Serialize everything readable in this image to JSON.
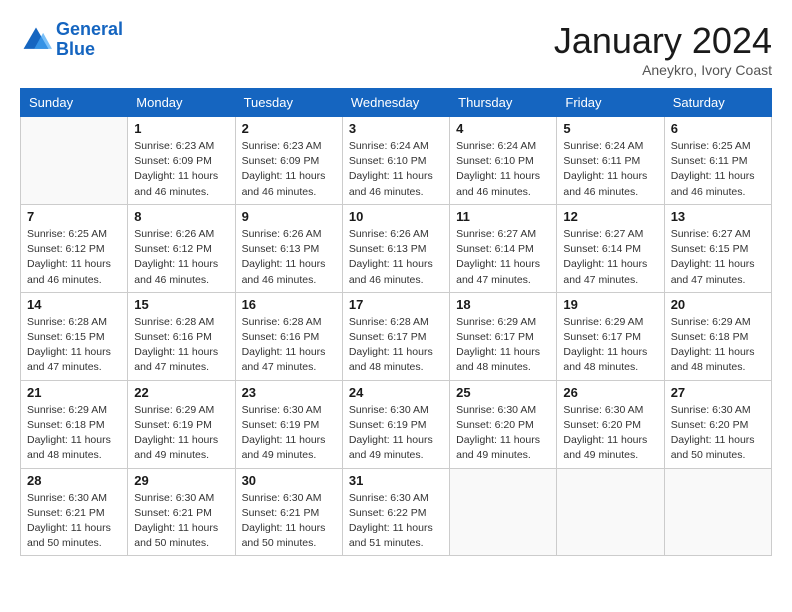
{
  "header": {
    "logo_line1": "General",
    "logo_line2": "Blue",
    "month_title": "January 2024",
    "location": "Aneykro, Ivory Coast"
  },
  "weekdays": [
    "Sunday",
    "Monday",
    "Tuesday",
    "Wednesday",
    "Thursday",
    "Friday",
    "Saturday"
  ],
  "weeks": [
    [
      {
        "day": "",
        "info": ""
      },
      {
        "day": "1",
        "info": "Sunrise: 6:23 AM\nSunset: 6:09 PM\nDaylight: 11 hours and 46 minutes."
      },
      {
        "day": "2",
        "info": "Sunrise: 6:23 AM\nSunset: 6:09 PM\nDaylight: 11 hours and 46 minutes."
      },
      {
        "day": "3",
        "info": "Sunrise: 6:24 AM\nSunset: 6:10 PM\nDaylight: 11 hours and 46 minutes."
      },
      {
        "day": "4",
        "info": "Sunrise: 6:24 AM\nSunset: 6:10 PM\nDaylight: 11 hours and 46 minutes."
      },
      {
        "day": "5",
        "info": "Sunrise: 6:24 AM\nSunset: 6:11 PM\nDaylight: 11 hours and 46 minutes."
      },
      {
        "day": "6",
        "info": "Sunrise: 6:25 AM\nSunset: 6:11 PM\nDaylight: 11 hours and 46 minutes."
      }
    ],
    [
      {
        "day": "7",
        "info": "Sunrise: 6:25 AM\nSunset: 6:12 PM\nDaylight: 11 hours and 46 minutes."
      },
      {
        "day": "8",
        "info": "Sunrise: 6:26 AM\nSunset: 6:12 PM\nDaylight: 11 hours and 46 minutes."
      },
      {
        "day": "9",
        "info": "Sunrise: 6:26 AM\nSunset: 6:13 PM\nDaylight: 11 hours and 46 minutes."
      },
      {
        "day": "10",
        "info": "Sunrise: 6:26 AM\nSunset: 6:13 PM\nDaylight: 11 hours and 46 minutes."
      },
      {
        "day": "11",
        "info": "Sunrise: 6:27 AM\nSunset: 6:14 PM\nDaylight: 11 hours and 47 minutes."
      },
      {
        "day": "12",
        "info": "Sunrise: 6:27 AM\nSunset: 6:14 PM\nDaylight: 11 hours and 47 minutes."
      },
      {
        "day": "13",
        "info": "Sunrise: 6:27 AM\nSunset: 6:15 PM\nDaylight: 11 hours and 47 minutes."
      }
    ],
    [
      {
        "day": "14",
        "info": "Sunrise: 6:28 AM\nSunset: 6:15 PM\nDaylight: 11 hours and 47 minutes."
      },
      {
        "day": "15",
        "info": "Sunrise: 6:28 AM\nSunset: 6:16 PM\nDaylight: 11 hours and 47 minutes."
      },
      {
        "day": "16",
        "info": "Sunrise: 6:28 AM\nSunset: 6:16 PM\nDaylight: 11 hours and 47 minutes."
      },
      {
        "day": "17",
        "info": "Sunrise: 6:28 AM\nSunset: 6:17 PM\nDaylight: 11 hours and 48 minutes."
      },
      {
        "day": "18",
        "info": "Sunrise: 6:29 AM\nSunset: 6:17 PM\nDaylight: 11 hours and 48 minutes."
      },
      {
        "day": "19",
        "info": "Sunrise: 6:29 AM\nSunset: 6:17 PM\nDaylight: 11 hours and 48 minutes."
      },
      {
        "day": "20",
        "info": "Sunrise: 6:29 AM\nSunset: 6:18 PM\nDaylight: 11 hours and 48 minutes."
      }
    ],
    [
      {
        "day": "21",
        "info": "Sunrise: 6:29 AM\nSunset: 6:18 PM\nDaylight: 11 hours and 48 minutes."
      },
      {
        "day": "22",
        "info": "Sunrise: 6:29 AM\nSunset: 6:19 PM\nDaylight: 11 hours and 49 minutes."
      },
      {
        "day": "23",
        "info": "Sunrise: 6:30 AM\nSunset: 6:19 PM\nDaylight: 11 hours and 49 minutes."
      },
      {
        "day": "24",
        "info": "Sunrise: 6:30 AM\nSunset: 6:19 PM\nDaylight: 11 hours and 49 minutes."
      },
      {
        "day": "25",
        "info": "Sunrise: 6:30 AM\nSunset: 6:20 PM\nDaylight: 11 hours and 49 minutes."
      },
      {
        "day": "26",
        "info": "Sunrise: 6:30 AM\nSunset: 6:20 PM\nDaylight: 11 hours and 49 minutes."
      },
      {
        "day": "27",
        "info": "Sunrise: 6:30 AM\nSunset: 6:20 PM\nDaylight: 11 hours and 50 minutes."
      }
    ],
    [
      {
        "day": "28",
        "info": "Sunrise: 6:30 AM\nSunset: 6:21 PM\nDaylight: 11 hours and 50 minutes."
      },
      {
        "day": "29",
        "info": "Sunrise: 6:30 AM\nSunset: 6:21 PM\nDaylight: 11 hours and 50 minutes."
      },
      {
        "day": "30",
        "info": "Sunrise: 6:30 AM\nSunset: 6:21 PM\nDaylight: 11 hours and 50 minutes."
      },
      {
        "day": "31",
        "info": "Sunrise: 6:30 AM\nSunset: 6:22 PM\nDaylight: 11 hours and 51 minutes."
      },
      {
        "day": "",
        "info": ""
      },
      {
        "day": "",
        "info": ""
      },
      {
        "day": "",
        "info": ""
      }
    ]
  ]
}
